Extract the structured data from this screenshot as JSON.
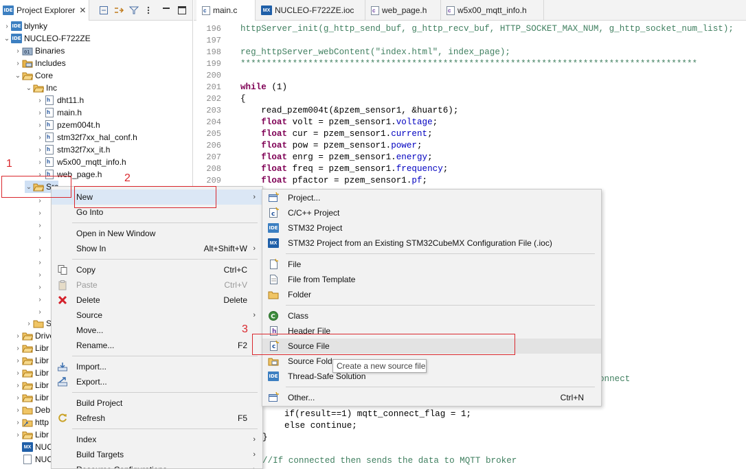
{
  "explorer": {
    "tab_label": "Project Explorer",
    "close_glyph": "✕",
    "toolbar": [
      "collapse-all-icon",
      "link-editor-icon",
      "filter-icon",
      "minimize-icon",
      "maximize-icon"
    ],
    "tree": [
      {
        "label": "blynky",
        "icon": "ide-project-icon",
        "indent": 0,
        "chev": "›"
      },
      {
        "label": "NUCLEO-F722ZE",
        "icon": "ide-project-icon",
        "indent": 0,
        "chev": "⌄"
      },
      {
        "label": "Binaries",
        "icon": "binaries-folder-icon",
        "indent": 1,
        "chev": "›"
      },
      {
        "label": "Includes",
        "icon": "includes-folder-icon",
        "indent": 1,
        "chev": "›"
      },
      {
        "label": "Core",
        "icon": "source-folder-icon",
        "indent": 1,
        "chev": "⌄"
      },
      {
        "label": "Inc",
        "icon": "source-folder-icon",
        "indent": 2,
        "chev": "⌄"
      },
      {
        "label": "dht11.h",
        "icon": "header-file-icon",
        "indent": 3,
        "chev": "›"
      },
      {
        "label": "main.h",
        "icon": "header-file-icon",
        "indent": 3,
        "chev": "›"
      },
      {
        "label": "pzem004t.h",
        "icon": "header-file-icon",
        "indent": 3,
        "chev": "›"
      },
      {
        "label": "stm32f7xx_hal_conf.h",
        "icon": "header-file-icon",
        "indent": 3,
        "chev": "›"
      },
      {
        "label": "stm32f7xx_it.h",
        "icon": "header-file-icon",
        "indent": 3,
        "chev": "›"
      },
      {
        "label": "w5x00_mqtt_info.h",
        "icon": "header-file-icon",
        "indent": 3,
        "chev": "›"
      },
      {
        "label": "web_page.h",
        "icon": "header-file-icon",
        "indent": 3,
        "chev": "›"
      },
      {
        "label": "Src",
        "icon": "source-folder-icon",
        "indent": 2,
        "chev": "⌄"
      }
    ],
    "partial_rows": [
      {
        "label": "S",
        "indent": 2
      },
      {
        "label": "Drivers",
        "indent": 1
      },
      {
        "label": "Libr",
        "indent": 1
      },
      {
        "label": "Libr",
        "indent": 1
      },
      {
        "label": "Libr",
        "indent": 1
      },
      {
        "label": "Libr",
        "indent": 1
      },
      {
        "label": "Libr",
        "indent": 1
      },
      {
        "label": "Deb",
        "indent": 1
      },
      {
        "label": "http",
        "indent": 1
      },
      {
        "label": "Libr",
        "indent": 1
      },
      {
        "label": "NUC",
        "indent": 1
      },
      {
        "label": "NUC",
        "indent": 1
      }
    ]
  },
  "editor": {
    "tabs": [
      {
        "label": "main.c",
        "icon": "c-file-icon",
        "active": true
      },
      {
        "label": "NUCLEO-F722ZE.ioc",
        "icon": "mx-file-icon",
        "active": false
      },
      {
        "label": "web_page.h",
        "icon": "c-file-icon",
        "active": false
      },
      {
        "label": "w5x00_mqtt_info.h",
        "icon": "c-file-icon",
        "active": false
      }
    ],
    "line_numbers": [
      "196",
      "197",
      "198",
      "199",
      "200",
      "201",
      "202",
      "203",
      "204",
      "205",
      "206",
      "207",
      "208",
      "209"
    ],
    "visible_fragments": {
      "connect": "onnect",
      "if_line": "if(result==1) mqtt_connect_flag = 1;",
      "else_line": "else continue;",
      "brace": "}",
      "comment": "//If connected then sends the data to MQTT broker"
    }
  },
  "context_menu": {
    "items": [
      {
        "label": "New",
        "shortcut": "",
        "arrow": "›",
        "icon": "",
        "highlight": true
      },
      {
        "label": "Go Into",
        "shortcut": "",
        "arrow": "",
        "icon": ""
      },
      {
        "sep": true
      },
      {
        "label": "Open in New Window",
        "shortcut": "",
        "arrow": "",
        "icon": ""
      },
      {
        "label": "Show In",
        "shortcut": "Alt+Shift+W",
        "arrow": "›",
        "icon": ""
      },
      {
        "sep": true
      },
      {
        "label": "Copy",
        "shortcut": "Ctrl+C",
        "arrow": "",
        "icon": "copy-icon"
      },
      {
        "label": "Paste",
        "shortcut": "Ctrl+V",
        "arrow": "",
        "icon": "paste-icon",
        "disabled": true
      },
      {
        "label": "Delete",
        "shortcut": "Delete",
        "arrow": "",
        "icon": "delete-icon"
      },
      {
        "label": "Source",
        "shortcut": "",
        "arrow": "›",
        "icon": ""
      },
      {
        "label": "Move...",
        "shortcut": "",
        "arrow": "",
        "icon": ""
      },
      {
        "label": "Rename...",
        "shortcut": "F2",
        "arrow": "",
        "icon": ""
      },
      {
        "sep": true
      },
      {
        "label": "Import...",
        "shortcut": "",
        "arrow": "",
        "icon": "import-icon"
      },
      {
        "label": "Export...",
        "shortcut": "",
        "arrow": "",
        "icon": "export-icon"
      },
      {
        "sep": true
      },
      {
        "label": "Build Project",
        "shortcut": "",
        "arrow": "",
        "icon": ""
      },
      {
        "label": "Refresh",
        "shortcut": "F5",
        "arrow": "",
        "icon": "refresh-icon"
      },
      {
        "sep": true
      },
      {
        "label": "Index",
        "shortcut": "",
        "arrow": "›",
        "icon": ""
      },
      {
        "label": "Build Targets",
        "shortcut": "",
        "arrow": "›",
        "icon": ""
      },
      {
        "label": "Resource Configurations",
        "shortcut": "",
        "arrow": "›",
        "icon": ""
      }
    ]
  },
  "submenu": {
    "items": [
      {
        "label": "Project...",
        "shortcut": "",
        "icon": "new-project-icon"
      },
      {
        "label": "C/C++ Project",
        "shortcut": "",
        "icon": "c-project-icon"
      },
      {
        "label": "STM32 Project",
        "shortcut": "",
        "icon": "ide-project-icon"
      },
      {
        "label": "STM32 Project from an Existing STM32CubeMX Configuration File (.ioc)",
        "shortcut": "",
        "icon": "mx-file-icon"
      },
      {
        "sep": true
      },
      {
        "label": "File",
        "shortcut": "",
        "icon": "new-file-icon"
      },
      {
        "label": "File from Template",
        "shortcut": "",
        "icon": "file-template-icon"
      },
      {
        "label": "Folder",
        "shortcut": "",
        "icon": "folder-icon"
      },
      {
        "sep": true
      },
      {
        "label": "Class",
        "shortcut": "",
        "icon": "class-icon"
      },
      {
        "label": "Header File",
        "shortcut": "",
        "icon": "header-file-icon"
      },
      {
        "label": "Source File",
        "shortcut": "",
        "icon": "source-file-icon",
        "highlight": true
      },
      {
        "label": "Source Folder",
        "shortcut": "",
        "icon": "source-folder-icon"
      },
      {
        "label": "Thread-Safe Solution",
        "shortcut": "",
        "icon": "ide-project-icon"
      },
      {
        "sep": true
      },
      {
        "label": "Other...",
        "shortcut": "Ctrl+N",
        "icon": "other-icon"
      }
    ]
  },
  "tooltip": {
    "text": "Create a new source file"
  },
  "annotations": {
    "one": "1",
    "two": "2",
    "three": "3",
    "color": "#d9262c"
  }
}
